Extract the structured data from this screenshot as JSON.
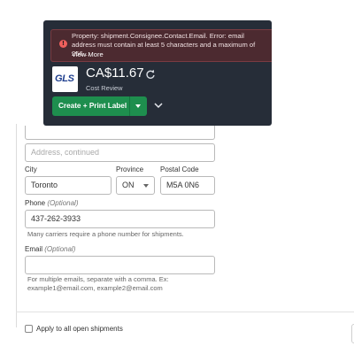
{
  "error": {
    "message": "Property: shipment.Consignee.Contact.Email. Error: email address must contain at least 5 characters and a maximum of 256…",
    "link": "View More",
    "icon": "error-circle-icon"
  },
  "carrier": {
    "logo_text": "GLS",
    "price": "CA$11.67",
    "refresh_icon": "refresh-icon",
    "subtitle": "Cost Review"
  },
  "actions": {
    "primary_label": "Create + Print Label",
    "dropdown_icon": "caret-down-icon",
    "expand_icon": "chevron-down-icon"
  },
  "form": {
    "address2_placeholder": "Address, continued",
    "city_label": "City",
    "city_value": "Toronto",
    "province_label": "Province",
    "province_value": "ON",
    "postal_label": "Postal Code",
    "postal_value": "M5A 0N6",
    "phone_label": "Phone",
    "phone_optional": "(Optional)",
    "phone_value": "437-262-3933",
    "phone_help": "Many carriers require a phone number for shipments.",
    "email_label": "Email",
    "email_optional": "(Optional)",
    "email_value": "",
    "email_help_line1": "For multiple emails, separate with a comma. Ex:",
    "email_help_line2": "example1@email.com, example2@email.com",
    "apply_label": "Apply to all open shipments"
  },
  "colors": {
    "popover_bg": "#262d38",
    "error_bg": "#4c2a30",
    "error_icon": "#f0605d",
    "primary_button": "#1e8e4e"
  }
}
